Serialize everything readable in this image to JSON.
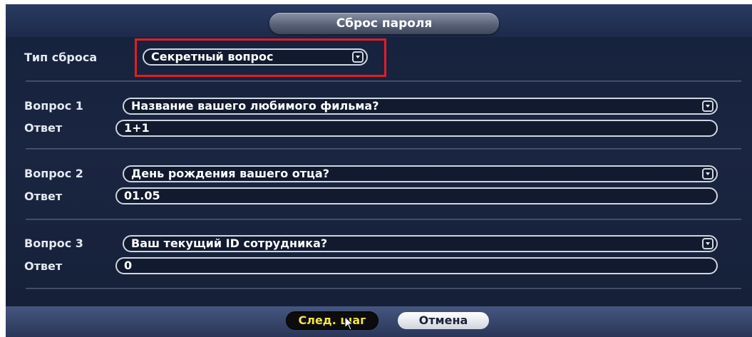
{
  "dialog": {
    "title": "Сброс пароля"
  },
  "reset_type": {
    "label": "Тип сброса",
    "value": "Секретный вопрос"
  },
  "questions": [
    {
      "label": "Вопрос 1",
      "value": "Название вашего любимого фильма?",
      "answer_label": "Ответ",
      "answer": "1+1"
    },
    {
      "label": "Вопрос 2",
      "value": "День рождения вашего отца?",
      "answer_label": "Ответ",
      "answer": "01.05"
    },
    {
      "label": "Вопрос 3",
      "value": "Ваш текущий ID сотрудника?",
      "answer_label": "Ответ",
      "answer": "0"
    }
  ],
  "buttons": {
    "next": "След. шаг",
    "cancel": "Отмена"
  },
  "colors": {
    "highlight": "#e11d26",
    "background": "#1a2541",
    "next_text": "#f1e24a"
  },
  "icons": [
    "chevron-down-icon",
    "mouse-cursor-icon"
  ]
}
